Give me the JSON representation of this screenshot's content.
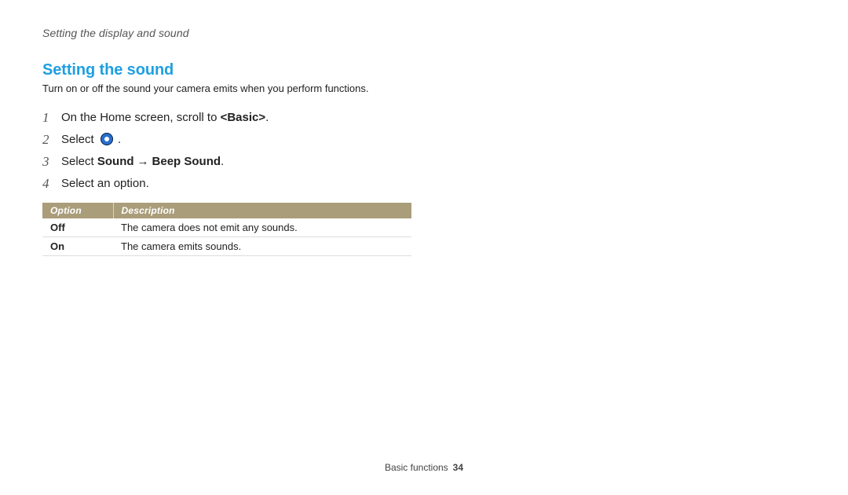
{
  "breadcrumb": "Setting the display and sound",
  "heading": "Setting the sound",
  "intro": "Turn on or off the sound your camera emits when you perform functions.",
  "steps": {
    "s1_pre": "On the Home screen, scroll to ",
    "s1_bold": "<Basic>",
    "s1_post": ".",
    "s2_pre": "Select ",
    "s2_post": " .",
    "s3_pre": "Select ",
    "s3_b1": "Sound",
    "s3_arrow": "→",
    "s3_b2": "Beep Sound",
    "s3_post": ".",
    "s4": "Select an option."
  },
  "table": {
    "h1": "Option",
    "h2": "Description",
    "rows": [
      {
        "opt": "Off",
        "desc": "The camera does not emit any sounds."
      },
      {
        "opt": "On",
        "desc": "The camera emits sounds."
      }
    ]
  },
  "footer": {
    "section": "Basic functions",
    "page": "34"
  }
}
